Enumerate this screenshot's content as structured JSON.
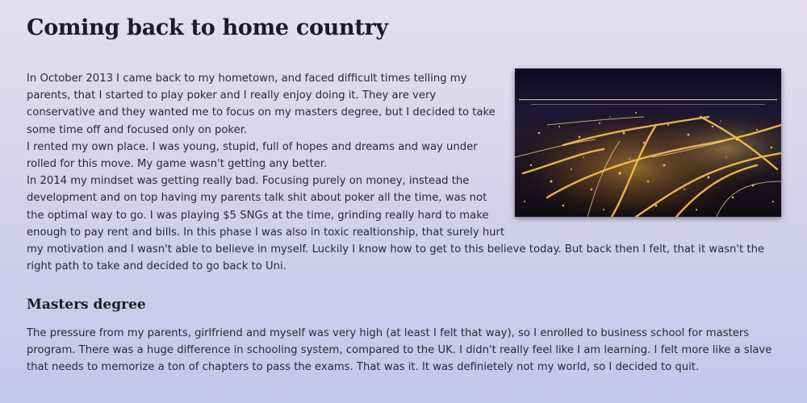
{
  "page": {
    "title": "Coming back to home country"
  },
  "article": {
    "image_alt": "Aerial night view of a city with illuminated streets",
    "paragraphs": [
      "In October 2013 I came back to my hometown, and faced difficult times telling my parents, that I started to play poker and I really enjoy doing it. They are very conservative and they wanted me to focus on my masters degree, but I decided to take some time off and focused only on poker.",
      "I rented my own place. I was young, stupid, full of hopes and dreams and way under rolled for this move. My game wasn't getting any better.",
      "In 2014 my mindset was getting really bad. Focusing purely on money, instead the development and on top having my parents talk shit about poker all the time, was not the optimal way to go. I was playing $5 SNGs at the time, grinding really hard to make enough to pay rent and bills. In this phase I was also in toxic realtionship, that surely hurt my motivation and I wasn't able to believe in myself. Luckily I know how to get to this believe today. But back then I felt, that it wasn't the right path to take and decided to go back to Uni."
    ]
  },
  "section": {
    "heading": "Masters degree",
    "body": "The pressure from my parents, girlfriend and myself was very high (at least I felt that way), so I enrolled to business school for masters program. There was a huge difference in schooling system, compared to the UK. I didn't really feel like I am learning. I felt more like a slave that needs to memorize a ton of chapters to pass the exams. That was it. It was definietely not my world, so I decided to quit."
  }
}
